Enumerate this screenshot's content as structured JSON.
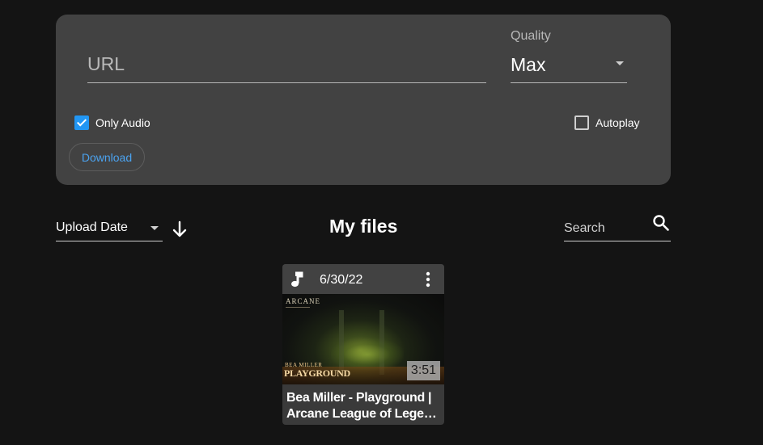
{
  "download_form": {
    "url_placeholder": "URL",
    "url_value": "",
    "quality": {
      "label": "Quality",
      "selected": "Max"
    },
    "only_audio": {
      "label": "Only Audio",
      "checked": true
    },
    "autoplay": {
      "label": "Autoplay",
      "checked": false
    },
    "download_label": "Download"
  },
  "toolbar": {
    "sort_by": "Upload Date",
    "sort_direction": "descending",
    "title": "My files",
    "search_placeholder": "Search"
  },
  "files": [
    {
      "type_icon": "music-note-icon",
      "date": "6/30/22",
      "thumbnail": {
        "brand": "ARCANE",
        "artist": "BEA MILLER",
        "song": "PLAYGROUND"
      },
      "duration": "3:51",
      "title_line1": "Bea Miller - Playground |",
      "title_line2": "Arcane League of Legend..."
    }
  ],
  "colors": {
    "background": "#141414",
    "card": "#424242",
    "accent": "#2196f3",
    "link": "#4ba3f0"
  }
}
